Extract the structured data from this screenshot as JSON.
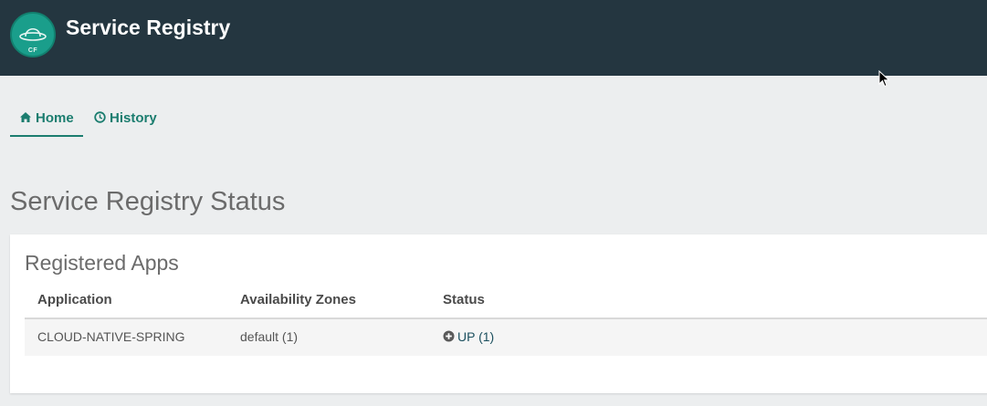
{
  "header": {
    "title": "Service Registry",
    "logo_text": "CF",
    "background_color": "#243640",
    "logo_color": "#1a9e8b"
  },
  "nav": {
    "tabs": [
      {
        "label": "Home",
        "icon": "home-icon",
        "active": true
      },
      {
        "label": "History",
        "icon": "clock-icon",
        "active": false
      }
    ],
    "accent_color": "#1b7d6f"
  },
  "main": {
    "page_title": "Service Registry Status",
    "panel": {
      "title": "Registered Apps",
      "columns": [
        "Application",
        "Availability Zones",
        "Status"
      ],
      "rows": [
        {
          "application": "CLOUD-NATIVE-SPRING",
          "zones": "default (1)",
          "status": "UP (1)",
          "status_icon": "plus-circle-icon"
        }
      ]
    }
  }
}
